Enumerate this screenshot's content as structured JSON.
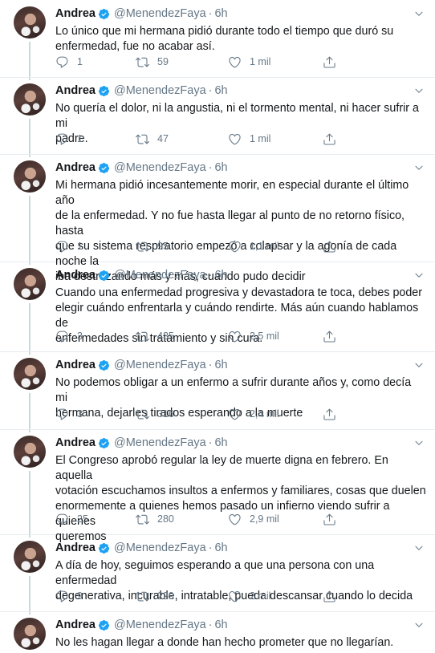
{
  "author": {
    "name": "Andrea",
    "handle": "@MenendezFaya",
    "time": "6h",
    "separator": "·"
  },
  "icons": {
    "verified": "verified-badge-icon",
    "more": "chevron-down-icon",
    "reply": "reply-icon",
    "retweet": "retweet-icon",
    "like": "like-icon",
    "share": "share-icon"
  },
  "colors": {
    "accent": "#1da1f2",
    "muted": "#657786",
    "text": "#14171a",
    "divider": "#e6ecf0"
  },
  "tweets": [
    {
      "lines": [
        "Lo único que mi hermana pidió durante todo el tiempo que duró su",
        "enfermedad, fue no acabar así."
      ],
      "replies": "1",
      "retweets": "59",
      "likes": "1 mil"
    },
    {
      "lines": [
        "No quería el dolor, ni la angustia, ni el tormento mental, ni hacer sufrir a mi",
        "padre."
      ],
      "replies": "1",
      "retweets": "47",
      "likes": "1 mil"
    },
    {
      "lines": [
        "Mi hermana pidió incesantemente morir, en especial durante el último año",
        "de la enfermedad. Y no fue hasta llegar al punto de no retorno físico, hasta",
        "que su sistema respiratorio empezó a colapsar y la agonía de cada noche la",
        "iba destrozando más y más, cuando pudo decidir"
      ],
      "replies": "1",
      "retweets": "95",
      "likes": "1,1 mil"
    },
    {
      "lines": [
        "Cuando una enfermedad progresiva y devastadora te toca, debes poder",
        "elegir cuándo enfrentarla y cuándo rendirte. Más aún cuando hablamos de",
        "enfermedades sin tratamiento y sin cura."
      ],
      "replies": "3",
      "retweets": "435",
      "likes": "2,5 mil"
    },
    {
      "lines": [
        "No podemos obligar a un enfermo a sufrir durante años y, como decía mi",
        "hermana, dejarles tirados esperando a la muerte"
      ],
      "replies": "3",
      "retweets": "316",
      "likes": "2,4 mil"
    },
    {
      "lines": [
        "El Congreso aprobó regular la ley de muerte digna en febrero. En aquella",
        "votación escuchamos insultos a enfermos y familiares, cosas que duelen",
        "enormemente a quienes hemos pasado un infierno viendo sufrir a quienes",
        "queremos"
      ],
      "replies": "25",
      "retweets": "280",
      "likes": "2,9 mil"
    },
    {
      "lines": [
        "A día de hoy, seguimos esperando a que una persona con una enfermedad",
        "degenerativa, incurable, intratable, pueda descansar cuando lo decida"
      ],
      "replies": "9",
      "retweets": "229",
      "likes": "2 mil"
    },
    {
      "lines": [
        "No les hagan llegar a donde han hecho prometer que no llegarían."
      ],
      "replies": "",
      "retweets": "",
      "likes": ""
    }
  ]
}
